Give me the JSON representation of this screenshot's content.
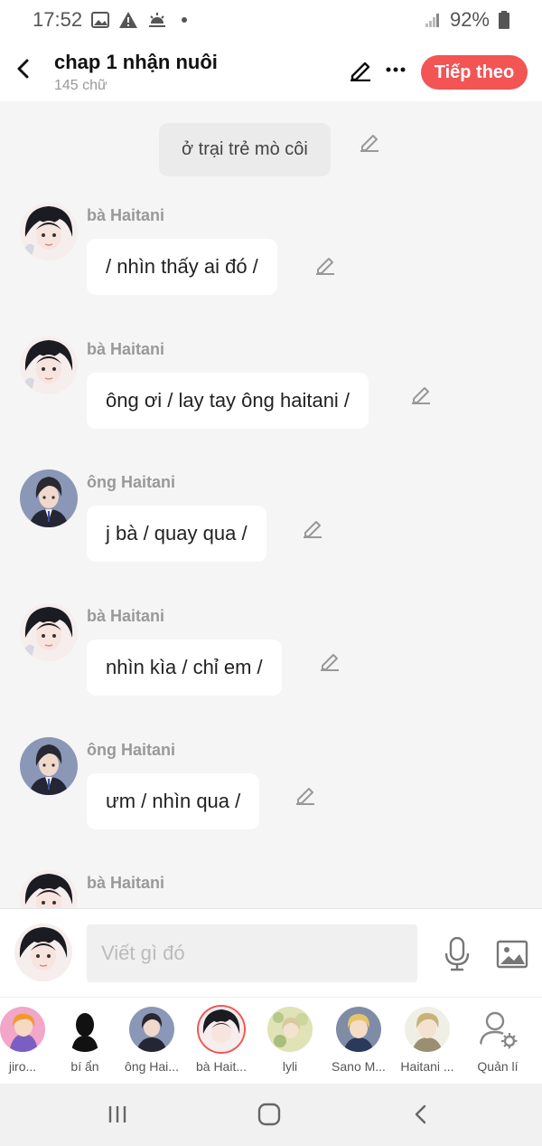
{
  "status_bar": {
    "time": "17:52",
    "battery": "92%"
  },
  "header": {
    "title": "chap 1 nhận nuôi",
    "word_count": "145 chữ",
    "next_label": "Tiếp theo"
  },
  "colors": {
    "accent": "#f35454",
    "background": "#f5f5f5"
  },
  "chat": {
    "narration": "ở trại trẻ mò côi",
    "messages": [
      {
        "sender": "bà Haitani",
        "text": "/ nhìn thấy ai đó /"
      },
      {
        "sender": "bà Haitani",
        "text": "ông ơi / lay tay ông haitani /"
      },
      {
        "sender": "ông Haitani",
        "text": "j bà / quay qua /"
      },
      {
        "sender": "bà Haitani",
        "text": "nhìn kìa / chỉ em /"
      },
      {
        "sender": "ông Haitani",
        "text": "ưm / nhìn qua /"
      },
      {
        "sender": "bà Haitani",
        "text": ""
      }
    ]
  },
  "input": {
    "placeholder": "Viết gì đó"
  },
  "characters": [
    {
      "label": "jiro..."
    },
    {
      "label": "bí ẩn"
    },
    {
      "label": "ông Hai..."
    },
    {
      "label": "bà Hait..."
    },
    {
      "label": "lyli"
    },
    {
      "label": "Sano M..."
    },
    {
      "label": "Haitani ..."
    },
    {
      "label": "Quản lí"
    }
  ],
  "icons": {
    "back": "back-arrow-icon",
    "edit": "pencil-icon",
    "more": "more-dots-icon",
    "mic": "microphone-icon",
    "image": "image-icon",
    "manage": "user-gear-icon"
  }
}
